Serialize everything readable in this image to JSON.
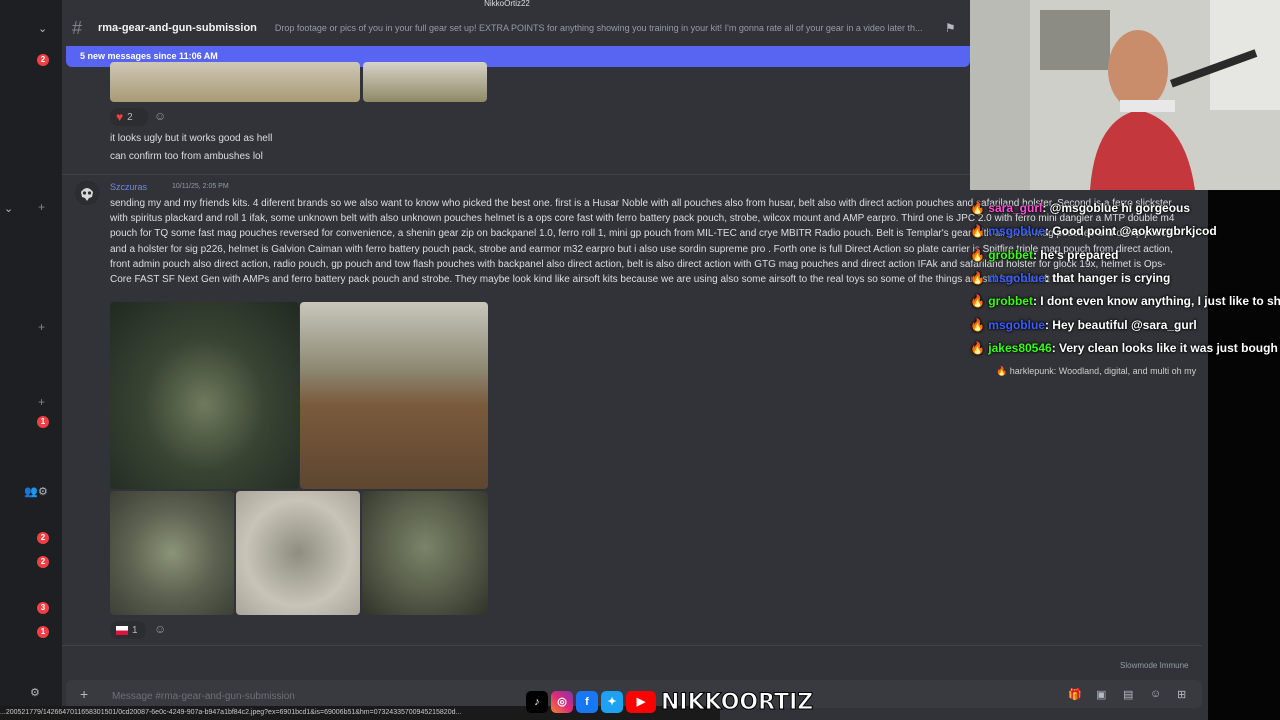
{
  "stream_title": "NikkoOrtiz22",
  "channel": {
    "name": "rma-gear-and-gun-submission",
    "topic": "Drop footage or pics of you in your full gear set up! EXTRA POINTS for anything showing you training in your kit! I'm gonna rate all of your gear in a video later th..."
  },
  "new_messages_banner": "5 new messages since 11:06 AM",
  "rail": {
    "badges": [
      "2",
      "1",
      "2",
      "2",
      "3",
      "1"
    ]
  },
  "messages": {
    "prev_reaction_count": "2",
    "line1": "it looks ugly but it works good as hell",
    "line2": "can confirm too from ambushes lol",
    "main": {
      "author": "Szczuras",
      "timestamp": "10/11/25, 2:05 PM",
      "text": "sending my and my friends kits. 4 diferent brands so we also want to know who picked the best one. first is a Husar Noble with all pouches also from husar, belt also with direct action pouches and safariland holster. Second is a ferro slickster with spiritus plackard and roll 1 ifak, some unknown belt with also unknown pouches helmet is a ops core fast with ferro battery pack pouch, strobe, wilcox mount and AMP earpro. Third one is JPC 2.0 with ferro mini dangler a MTP double m4 pouch for TQ some fast mag pouches reversed for convenience, a shenin gear zip on backpanel 1.0, ferro roll 1, mini gp pouch from MIL-TEC and crye MBITR Radio pouch. Belt is Templar's gear with all given mag pouches and dump pouch and a holster for sig p226, helmet is Galvion Caiman with ferro battery pouch pack, strobe and earmor m32 earpro but i also use sordin supreme pro . Forth one is full Direct Action so plate carrier is Spitfire triple mag pouch from direct action, front admin pouch also direct action, radio pouch, gp pouch and tow flash pouches with backpanel also direct action, belt is also direct action with GTG mag pouches and direct action IFAk and safariland holster for glock 19x, helmet is Ops-Core FAST SF Next Gen with AMPs and ferro battery pack pouch and strobe. They maybe look kind like airsoft kits because we are using also some airsoft to the real toys so some of the things are still form airsoft kits",
      "reaction_count": "1"
    }
  },
  "composer": {
    "placeholder": "Message #rma-gear-and-gun-submission"
  },
  "slowmode": "Slowmode Immune",
  "url_text": "...200521779/1426647011658301501/0cd20087-6e0c-4249-907a-b947a1bf84c2.jpeg?ex=6901bcd1&is=69006b51&hm=07324335700945215820d...",
  "chat": [
    {
      "user": "sara_gurl",
      "color": "#ff4fd8",
      "text": ": @msgoblue hi gorgeous"
    },
    {
      "user": "msgoblue",
      "color": "#3b5cff",
      "text": ": Good point @aokwrgbrkjcod"
    },
    {
      "user": "grobbet",
      "color": "#39ff14",
      "text": ": he's prepared"
    },
    {
      "user": "msgoblue",
      "color": "#3b5cff",
      "text": ": that hanger is crying"
    },
    {
      "user": "grobbet",
      "color": "#39ff14",
      "text": ": I dont even know anything, I just like to shi"
    },
    {
      "user": "msgoblue",
      "color": "#3b5cff",
      "text": ": Hey beautiful @sara_gurl"
    },
    {
      "user": "jakes80546",
      "color": "#39ff14",
      "text": ": Very clean looks like it was just bough"
    }
  ],
  "chat_small": {
    "user": "harklepunk",
    "text": ": Woodland, digital, and multi oh my"
  },
  "watermark": {
    "name": "NIKKOORTIZ"
  },
  "colors": {
    "accent": "#5865f2",
    "background": "#313338",
    "badge": "#f23f43"
  }
}
